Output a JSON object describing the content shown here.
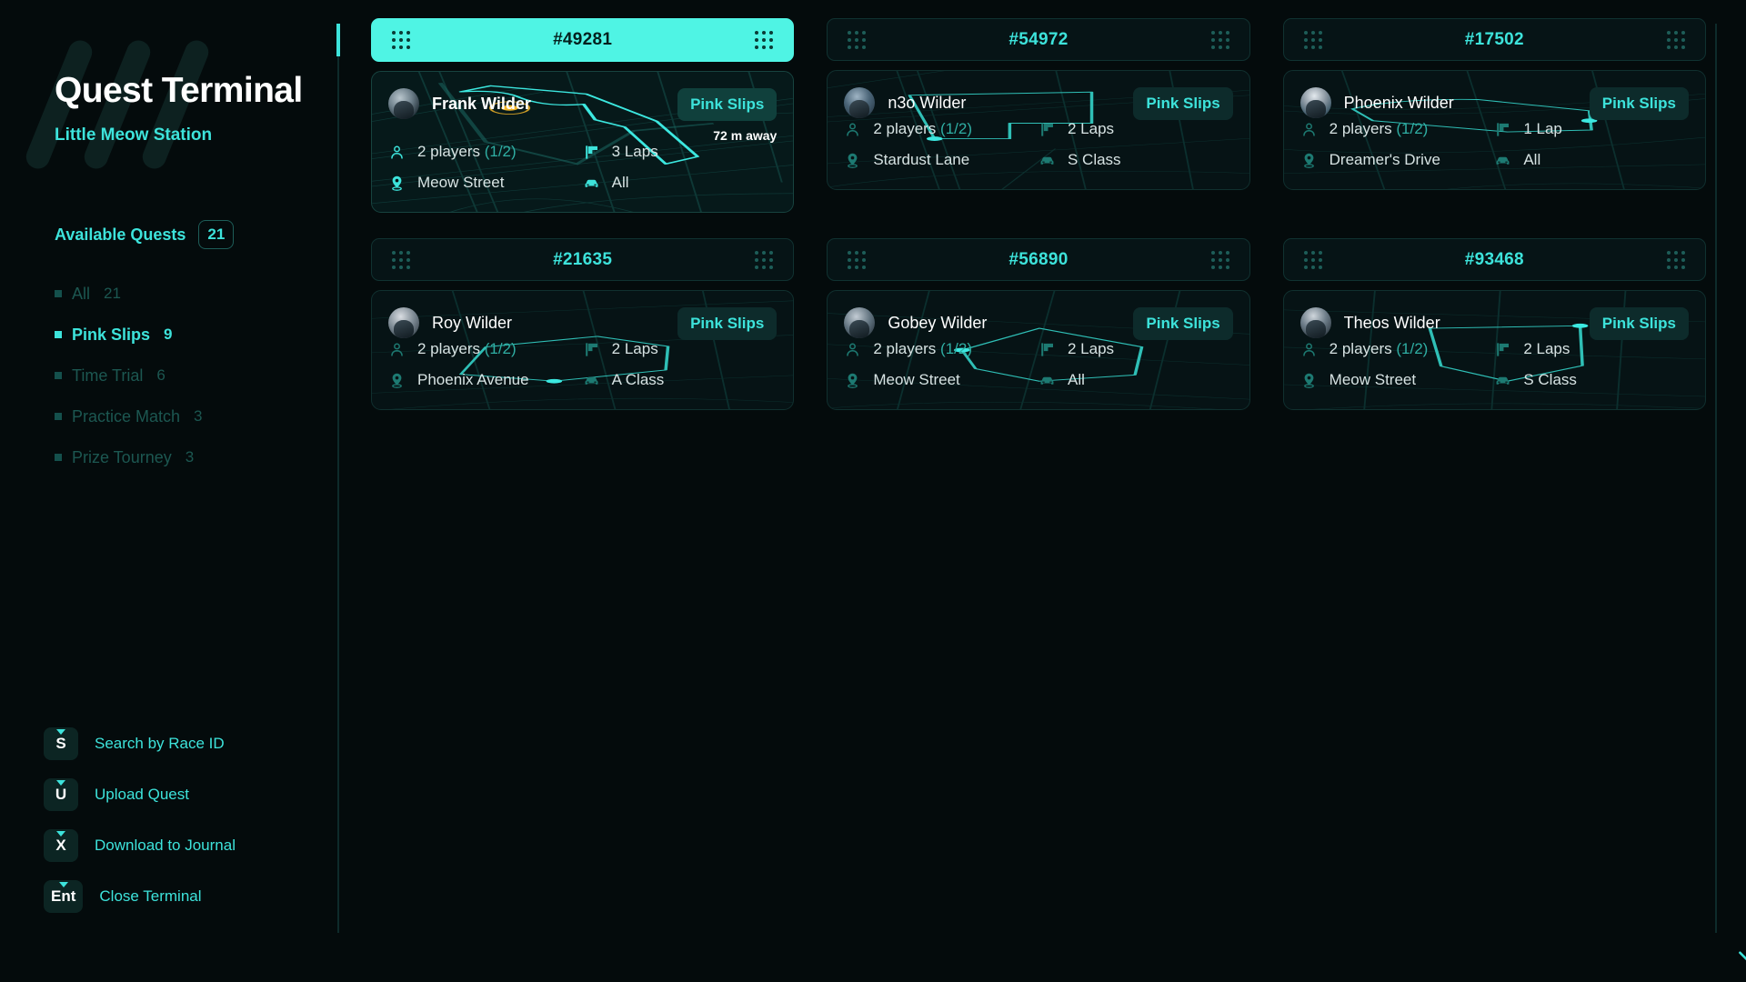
{
  "sidebar": {
    "title": "Quest Terminal",
    "subtitle": "Little Meow Station",
    "available_label": "Available Quests",
    "available_count": "21",
    "filters": [
      {
        "label": "All",
        "count": "21",
        "active": false
      },
      {
        "label": "Pink Slips",
        "count": "9",
        "active": true
      },
      {
        "label": "Time Trial",
        "count": "6",
        "active": false
      },
      {
        "label": "Practice Match",
        "count": "3",
        "active": false
      },
      {
        "label": "Prize Tourney",
        "count": "3",
        "active": false
      }
    ],
    "shortcuts": [
      {
        "key": "S",
        "label": "Search by Race ID"
      },
      {
        "key": "U",
        "label": "Upload Quest"
      },
      {
        "key": "X",
        "label": "Download to Journal"
      },
      {
        "key": "Ent",
        "label": "Close Terminal"
      }
    ]
  },
  "colors": {
    "accent": "#3de3db",
    "accent_bright": "#4ff4e4",
    "background": "#040b0c",
    "card_bg": "#061315",
    "marker": "#f0b429",
    "route": "#3ce8e0"
  },
  "cards": [
    {
      "race_id": "#49281",
      "player": "Frank Wilder",
      "badge": "Pink Slips",
      "distance": "72 m away",
      "active": true,
      "players": "2 players",
      "players_sub": "(1/2)",
      "laps": "3 Laps",
      "street": "Meow Street",
      "car_class": "All"
    },
    {
      "race_id": "#54972",
      "player": "n3o Wilder",
      "badge": "Pink Slips",
      "distance": "",
      "active": false,
      "players": "2 players",
      "players_sub": "(1/2)",
      "laps": "2 Laps",
      "street": "Stardust Lane",
      "car_class": "S Class"
    },
    {
      "race_id": "#17502",
      "player": "Phoenix Wilder",
      "badge": "Pink Slips",
      "distance": "",
      "active": false,
      "players": "2 players",
      "players_sub": "(1/2)",
      "laps": "1 Lap",
      "street": "Dreamer's Drive",
      "car_class": "All"
    },
    {
      "race_id": "#21635",
      "player": "Roy Wilder",
      "badge": "Pink Slips",
      "distance": "",
      "active": false,
      "players": "2 players",
      "players_sub": "(1/2)",
      "laps": "2 Laps",
      "street": "Phoenix Avenue",
      "car_class": "A Class"
    },
    {
      "race_id": "#56890",
      "player": "Gobey Wilder",
      "badge": "Pink Slips",
      "distance": "",
      "active": false,
      "players": "2 players",
      "players_sub": "(1/2)",
      "laps": "2 Laps",
      "street": "Meow Street",
      "car_class": "All"
    },
    {
      "race_id": "#93468",
      "player": "Theos Wilder",
      "badge": "Pink Slips",
      "distance": "",
      "active": false,
      "players": "2 players",
      "players_sub": "(1/2)",
      "laps": "2 Laps",
      "street": "Meow Street",
      "car_class": "S Class"
    }
  ]
}
